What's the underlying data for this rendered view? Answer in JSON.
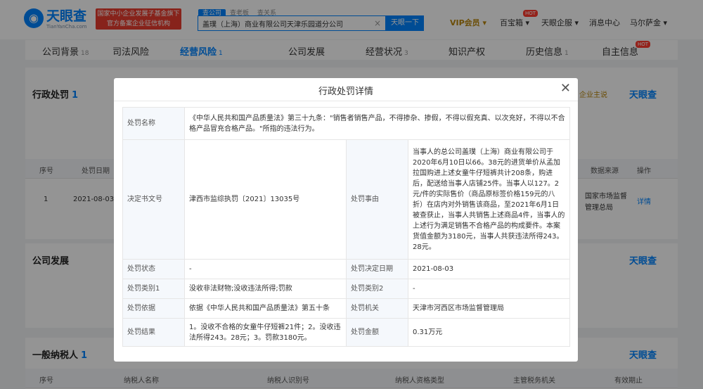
{
  "header": {
    "logo_text": "天眼查",
    "logo_domain": "TianYanCha.com",
    "banner_line1": "国家中小企业发展子基金旗下",
    "banner_line2": "官方备案企业征信机构",
    "search_tabs": [
      "查公司",
      "查老板",
      "查关系"
    ],
    "search_value": "盖璞（上海）商业有限公司天津乐园道分公司",
    "search_button": "天眼一下",
    "vip": "VIP会员",
    "nav": [
      "百宝箱",
      "天眼企服",
      "消息中心",
      "马尔萨金"
    ],
    "hot_badge": "HOT"
  },
  "tabs": [
    {
      "label": "公司背景",
      "count": "18"
    },
    {
      "label": "司法风险",
      "count": ""
    },
    {
      "label": "经营风险",
      "count": "1"
    },
    {
      "label": "公司发展",
      "count": ""
    },
    {
      "label": "经营状况",
      "count": "3"
    },
    {
      "label": "知识产权",
      "count": ""
    },
    {
      "label": "历史信息",
      "count": "1"
    },
    {
      "label": "自主信息",
      "count": ""
    }
  ],
  "background": {
    "admin_penalty_title": "行政处罚",
    "admin_penalty_count": "1",
    "follow_label": "企业主说",
    "brand": "天眼查",
    "table_headers": [
      "序号",
      "处罚日期",
      "数据来源",
      "操作"
    ],
    "row": {
      "no": "1",
      "date": "2021-08-03",
      "source": "国家市场监督管理总局",
      "action": "详情"
    },
    "company_dev_title": "公司发展",
    "taxpayer_title": "一般纳税人",
    "taxpayer_count": "1",
    "taxpayer_headers": [
      "序号",
      "纳税人名称",
      "纳税人识别号",
      "纳税人资格类型",
      "主管税务机关",
      "有效期止"
    ]
  },
  "modal": {
    "title": "行政处罚详情",
    "rows": {
      "penalty_name_label": "处罚名称",
      "penalty_name_value": "《中华人民共和国产品质量法》第三十九条：\"销售者销售产品，不得掺杂、掺假，不得以假充真、以次充好，不得以不合格产品冒充合格产品。\"所指的违法行为。",
      "doc_no_label": "决定书文号",
      "doc_no_value": "津西市监综执罚〔2021〕13035号",
      "reason_label": "处罚事由",
      "reason_value": "当事人的总公司盖璞（上海）商业有限公司于2020年6月10日以66。38元的进货单价从孟加拉国购进上述女童牛仔短裤共计208条，购进后，配送给当事人店铺25件。当事人以127。2元/件的实际售价（商品原标签价格159元的八折）在店内对外销售该商品，至2021年6月1日被查获止，当事人共销售上述商品4件，当事人的上述行为满足销售不合格产品的构成要件。本案货值金额为3180元，当事人共获违法所得243。28元。",
      "status_label": "处罚状态",
      "status_value": "-",
      "date_label": "处罚决定日期",
      "date_value": "2021-08-03",
      "type1_label": "处罚类别1",
      "type1_value": "没收非法财物;没收违法所得;罚款",
      "type2_label": "处罚类别2",
      "type2_value": "-",
      "basis_label": "处罚依据",
      "basis_value": "依据《中华人民共和国产品质量法》第五十条",
      "authority_label": "处罚机关",
      "authority_value": "天津市河西区市场监督管理局",
      "result_label": "处罚结果",
      "result_value": "1。没收不合格的女童牛仔短裤21件；2。没收违法所得243。28元；3。罚款3180元。",
      "amount_label": "处罚金额",
      "amount_value": "0.31万元"
    }
  },
  "colors": {
    "accent": "#0084ff",
    "banner": "#e93d2f",
    "hot": "#ff3b30"
  }
}
